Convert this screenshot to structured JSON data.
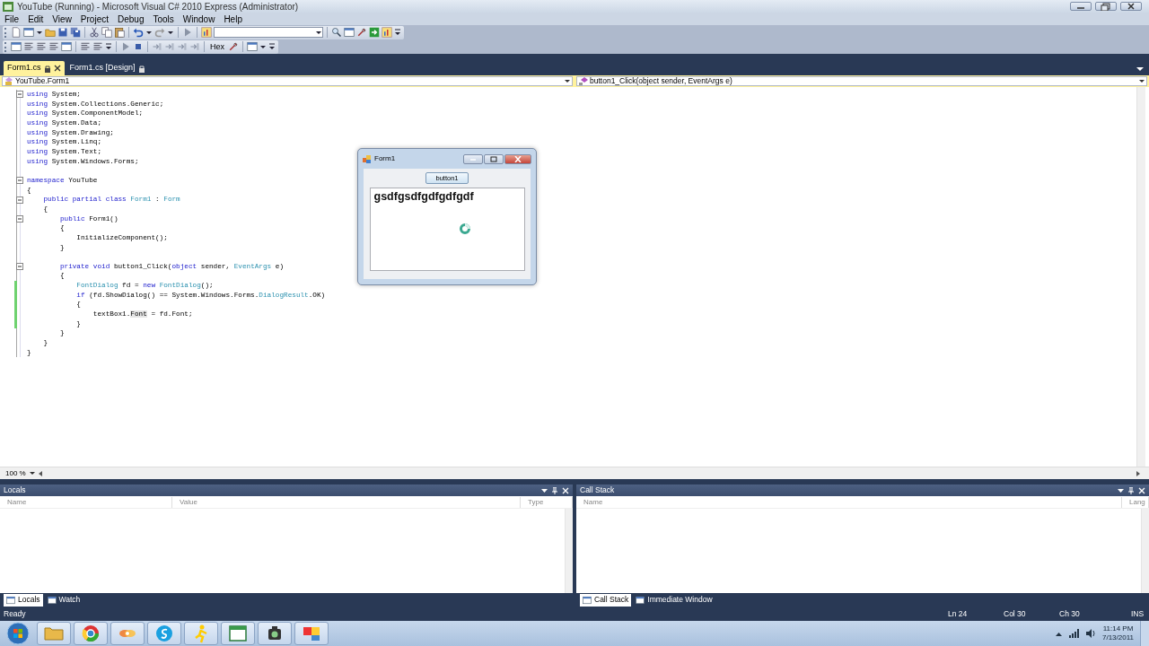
{
  "window": {
    "title": "YouTube (Running) - Microsoft Visual C# 2010 Express (Administrator)"
  },
  "menu": [
    "File",
    "Edit",
    "View",
    "Project",
    "Debug",
    "Tools",
    "Window",
    "Help"
  ],
  "toolbar": {
    "hex_label": "Hex"
  },
  "doc_tabs": [
    {
      "label": "Form1.cs",
      "selected": true
    },
    {
      "label": "Form1.cs [Design]",
      "selected": false
    }
  ],
  "nav": {
    "type_dropdown": "YouTube.Form1",
    "member_dropdown": "button1_Click(object sender, EventArgs e)"
  },
  "code_lines": [
    {
      "fold": true,
      "changed": false,
      "segments": [
        {
          "kind": "kw",
          "text": "using"
        },
        {
          "kind": "plain",
          "text": " System;"
        }
      ]
    },
    {
      "fold": false,
      "changed": false,
      "segments": [
        {
          "kind": "kw",
          "text": "using"
        },
        {
          "kind": "plain",
          "text": " System.Collections.Generic;"
        }
      ]
    },
    {
      "fold": false,
      "changed": false,
      "segments": [
        {
          "kind": "kw",
          "text": "using"
        },
        {
          "kind": "plain",
          "text": " System.ComponentModel;"
        }
      ]
    },
    {
      "fold": false,
      "changed": false,
      "segments": [
        {
          "kind": "kw",
          "text": "using"
        },
        {
          "kind": "plain",
          "text": " System.Data;"
        }
      ]
    },
    {
      "fold": false,
      "changed": false,
      "segments": [
        {
          "kind": "kw",
          "text": "using"
        },
        {
          "kind": "plain",
          "text": " System.Drawing;"
        }
      ]
    },
    {
      "fold": false,
      "changed": false,
      "segments": [
        {
          "kind": "kw",
          "text": "using"
        },
        {
          "kind": "plain",
          "text": " System.Linq;"
        }
      ]
    },
    {
      "fold": false,
      "changed": false,
      "segments": [
        {
          "kind": "kw",
          "text": "using"
        },
        {
          "kind": "plain",
          "text": " System.Text;"
        }
      ]
    },
    {
      "fold": false,
      "changed": false,
      "segments": [
        {
          "kind": "kw",
          "text": "using"
        },
        {
          "kind": "plain",
          "text": " System.Windows.Forms;"
        }
      ]
    },
    {
      "fold": false,
      "changed": false
    },
    {
      "fold": true,
      "changed": false,
      "segments": [
        {
          "kind": "kw",
          "text": "namespace"
        },
        {
          "kind": "plain",
          "text": " YouTube"
        }
      ]
    },
    {
      "fold": false,
      "changed": false,
      "segments": [
        {
          "kind": "plain",
          "text": "{"
        }
      ]
    },
    {
      "fold": true,
      "changed": false,
      "segments": [
        {
          "kind": "kw",
          "text": "    public partial class "
        },
        {
          "kind": "type",
          "text": "Form1"
        },
        {
          "kind": "plain",
          "text": " : "
        },
        {
          "kind": "type",
          "text": "Form"
        }
      ]
    },
    {
      "fold": false,
      "changed": false,
      "segments": [
        {
          "kind": "plain",
          "text": "    {"
        }
      ]
    },
    {
      "fold": true,
      "changed": false,
      "segments": [
        {
          "kind": "kw",
          "text": "        public"
        },
        {
          "kind": "plain",
          "text": " Form1()"
        }
      ]
    },
    {
      "fold": false,
      "changed": false,
      "segments": [
        {
          "kind": "plain",
          "text": "        {"
        }
      ]
    },
    {
      "fold": false,
      "changed": false,
      "segments": [
        {
          "kind": "plain",
          "text": "            InitializeComponent();"
        }
      ]
    },
    {
      "fold": false,
      "changed": false,
      "segments": [
        {
          "kind": "plain",
          "text": "        }"
        }
      ]
    },
    {
      "fold": false,
      "changed": false
    },
    {
      "fold": true,
      "changed": false,
      "segments": [
        {
          "kind": "kw",
          "text": "        private void"
        },
        {
          "kind": "plain",
          "text": " button1_Click("
        },
        {
          "kind": "kw",
          "text": "object"
        },
        {
          "kind": "plain",
          "text": " sender, "
        },
        {
          "kind": "type",
          "text": "EventArgs"
        },
        {
          "kind": "plain",
          "text": " e)"
        }
      ]
    },
    {
      "fold": false,
      "changed": false,
      "segments": [
        {
          "kind": "plain",
          "text": "        {"
        }
      ]
    },
    {
      "fold": false,
      "changed": true,
      "segments": [
        {
          "kind": "type",
          "text": "            FontDialog"
        },
        {
          "kind": "plain",
          "text": " fd = "
        },
        {
          "kind": "kw",
          "text": "new "
        },
        {
          "kind": "type",
          "text": "FontDialog"
        },
        {
          "kind": "plain",
          "text": "();"
        }
      ]
    },
    {
      "fold": false,
      "changed": true,
      "segments": [
        {
          "kind": "kw",
          "text": "            if"
        },
        {
          "kind": "plain",
          "text": " (fd.ShowDialog() == System.Windows.Forms."
        },
        {
          "kind": "type",
          "text": "DialogResult"
        },
        {
          "kind": "plain",
          "text": ".OK)"
        }
      ]
    },
    {
      "fold": false,
      "changed": true,
      "segments": [
        {
          "kind": "plain",
          "text": "            {"
        }
      ]
    },
    {
      "fold": false,
      "changed": true,
      "segments": [
        {
          "kind": "plain",
          "text": "                textBox1."
        },
        {
          "kind": "hl",
          "text": "Font"
        },
        {
          "kind": "plain",
          "text": " = fd.Font;"
        }
      ]
    },
    {
      "fold": false,
      "changed": true,
      "segments": [
        {
          "kind": "plain",
          "text": "            }"
        }
      ]
    },
    {
      "fold": false,
      "changed": false,
      "segments": [
        {
          "kind": "plain",
          "text": "        }"
        }
      ]
    },
    {
      "fold": false,
      "changed": false,
      "segments": [
        {
          "kind": "plain",
          "text": "    }"
        }
      ]
    },
    {
      "fold": false,
      "changed": false,
      "segments": [
        {
          "kind": "plain",
          "text": "}"
        }
      ]
    }
  ],
  "zoom": "100 %",
  "form_window": {
    "title": "Form1",
    "button": "button1",
    "textbox_value": "gsdfgsdfgdfgdfgdf"
  },
  "panels": [
    {
      "title": "Locals",
      "columns": [
        "Name",
        "Value",
        "Type"
      ],
      "tabs": [
        {
          "label": "Locals",
          "selected": true
        },
        {
          "label": "Watch",
          "selected": false
        }
      ]
    },
    {
      "title": "Call Stack",
      "columns": [
        "Name",
        "Lang"
      ],
      "tabs": [
        {
          "label": "Call Stack",
          "selected": true
        },
        {
          "label": "Immediate Window",
          "selected": false
        }
      ]
    }
  ],
  "status_bar": {
    "message": "Ready",
    "ln": "Ln 24",
    "col": "Col 30",
    "ch": "Ch 30",
    "mode": "INS"
  },
  "taskbar": {
    "time": "11:14 PM",
    "date": "7/13/2011"
  }
}
